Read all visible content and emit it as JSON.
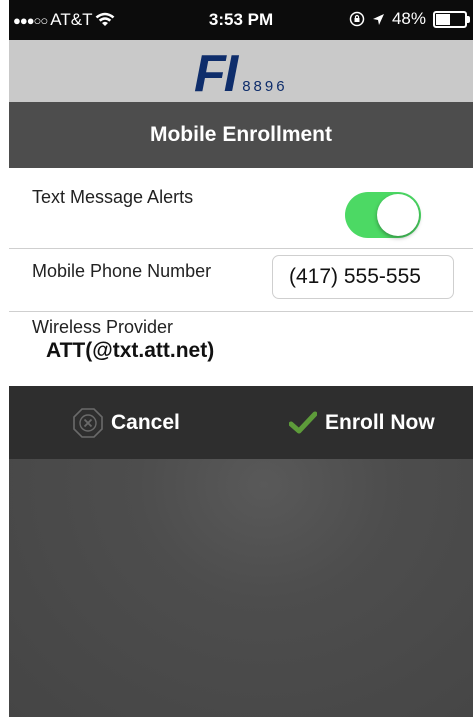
{
  "status_bar": {
    "signal": "●●●○○",
    "carrier": "AT&T",
    "time": "3:53 PM",
    "battery": "48%",
    "battery_level": 0.48
  },
  "brand": {
    "logo_text": "FI",
    "logo_number": "8896",
    "logo_color": "#0e2d6b"
  },
  "header": {
    "title": "Mobile Enrollment"
  },
  "form": {
    "text_alerts": {
      "label": "Text Message Alerts",
      "enabled": true,
      "toggle_color": "#4cd964"
    },
    "phone": {
      "label": "Mobile Phone Number",
      "value": "(417) 555-555"
    },
    "provider": {
      "label": "Wireless Provider",
      "value": "ATT(@txt.att.net)"
    }
  },
  "actions": {
    "cancel_label": "Cancel",
    "cancel_icon": "cancel-x-icon",
    "enroll_label": "Enroll Now",
    "enroll_icon": "checkmark-icon",
    "enroll_icon_color": "#5d9b3a"
  }
}
